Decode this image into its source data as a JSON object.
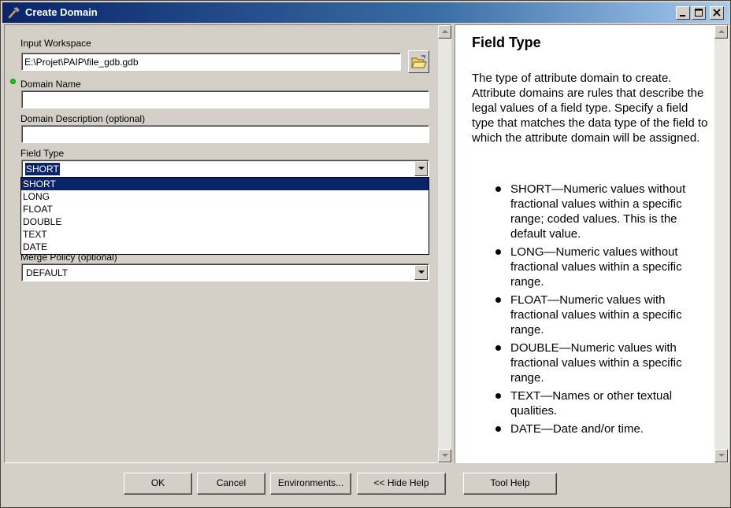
{
  "window": {
    "title": "Create Domain",
    "icon": "hammer-icon"
  },
  "form": {
    "input_workspace": {
      "label": "Input Workspace",
      "value": "E:\\Projet\\PAIP\\file_gdb.gdb"
    },
    "domain_name": {
      "label": "Domain Name",
      "value": ""
    },
    "domain_description": {
      "label": "Domain Description (optional)",
      "value": ""
    },
    "field_type": {
      "label": "Field Type",
      "value": "SHORT",
      "options": [
        "SHORT",
        "LONG",
        "FLOAT",
        "DOUBLE",
        "TEXT",
        "DATE"
      ]
    },
    "merge_policy": {
      "label": "Merge Policy (optional)",
      "value": "DEFAULT"
    }
  },
  "help": {
    "title": "Field Type",
    "description": "The type of attribute domain to create. Attribute domains are rules that describe the legal values of a field type. Specify a field type that matches the data type of the field to which the attribute domain will be assigned.",
    "items": [
      "SHORT—Numeric values without fractional values within a specific range; coded values. This is the default value.",
      "LONG—Numeric values without fractional values within a specific range.",
      "FLOAT—Numeric values with fractional values within a specific range.",
      "DOUBLE—Numeric values with fractional values within a specific range.",
      "TEXT—Names or other textual qualities.",
      "DATE—Date and/or time."
    ]
  },
  "buttons": {
    "ok": "OK",
    "cancel": "Cancel",
    "environments": "Environments...",
    "hide_help": "<< Hide Help",
    "tool_help": "Tool Help"
  },
  "colors": {
    "title_bar": "#0a246a",
    "selection": "#0a246a",
    "required_dot": "#19c919",
    "face": "#d4d0c8"
  }
}
